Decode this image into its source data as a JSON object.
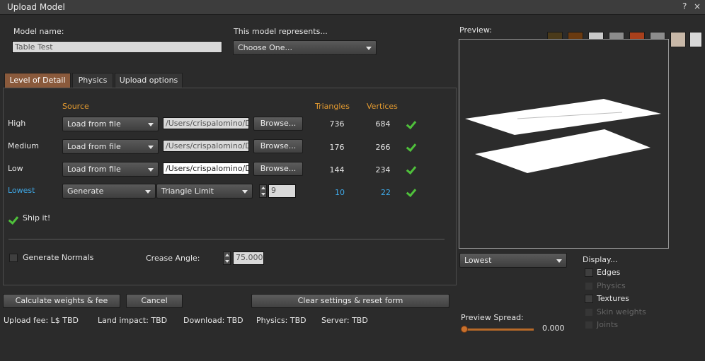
{
  "window": {
    "title": "Upload Model",
    "help": "?",
    "close": "×"
  },
  "model_name": {
    "label": "Model name:",
    "value": "Table Test"
  },
  "represents": {
    "label": "This model represents...",
    "value": "Choose One..."
  },
  "tabs": [
    {
      "label": "Level of Detail",
      "active": true
    },
    {
      "label": "Physics",
      "active": false
    },
    {
      "label": "Upload options",
      "active": false
    }
  ],
  "lod_headers": {
    "source": "Source",
    "triangles": "Triangles",
    "vertices": "Vertices"
  },
  "lod_rows": [
    {
      "label": "High",
      "source": "Load from file",
      "path": "/Users/crispalomino/D",
      "browse": "Browse...",
      "triangles": "736",
      "vertices": "684"
    },
    {
      "label": "Medium",
      "source": "Load from file",
      "path": "/Users/crispalomino/D",
      "browse": "Browse...",
      "triangles": "176",
      "vertices": "266"
    },
    {
      "label": "Low",
      "source": "Load from file",
      "path": "/Users/crispalomino/D",
      "browse": "Browse...",
      "triangles": "144",
      "vertices": "234"
    }
  ],
  "lowest": {
    "label": "Lowest",
    "source": "Generate",
    "mode": "Triangle Limit",
    "limit": "9",
    "triangles": "10",
    "vertices": "22"
  },
  "ship_it": "Ship it!",
  "normals": {
    "label": "Generate Normals",
    "crease_label": "Crease Angle:",
    "crease_value": "75.000"
  },
  "buttons": {
    "calculate": "Calculate weights & fee",
    "cancel": "Cancel",
    "clear": "Clear settings & reset form"
  },
  "fees": {
    "upload": "Upload fee: L$ TBD",
    "land": "Land impact: TBD",
    "download": "Download: TBD",
    "physics": "Physics: TBD",
    "server": "Server: TBD"
  },
  "preview": {
    "label": "Preview:",
    "lod_select": "Lowest",
    "display_label": "Display...",
    "options": [
      {
        "label": "Edges",
        "enabled": true
      },
      {
        "label": "Physics",
        "enabled": false
      },
      {
        "label": "Textures",
        "enabled": true
      },
      {
        "label": "Skin weights",
        "enabled": false
      },
      {
        "label": "Joints",
        "enabled": false
      }
    ],
    "spread_label": "Preview Spread:",
    "spread_value": "0.000"
  },
  "colors": {
    "accent_orange": "#e39a30",
    "lowest_blue": "#3fa9e8",
    "check_green": "#4fc13b",
    "active_tab": "#8a5a3c"
  }
}
